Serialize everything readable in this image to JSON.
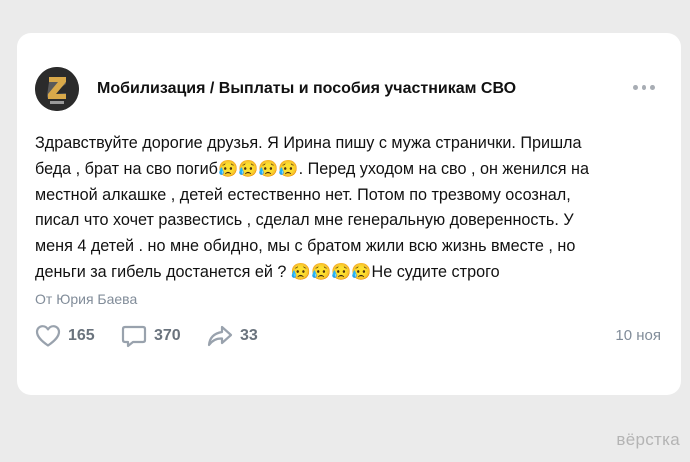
{
  "post": {
    "group_name": "Мобилизация / Выплаты и пособия участникам СВО",
    "text": "Здравствуйте дорогие друзья. Я Ирина пишу с мужа странички. Пришла\nбеда , брат на сво погиб😥😥😥😥. Перед уходом на сво , он женился на\nместной алкашке , детей естественно нет. Потом по трезвому осознал,\nписал что хочет развестись , сделал мне генеральную доверенность. У\nменя 4 детей . но мне обидно, мы с братом жили всю жизнь вместе , но\nденьги за гибель достанется ей ? 😥😥😥😥Не судите строго",
    "author": "От Юрия Баева",
    "likes": "165",
    "comments": "370",
    "shares": "33",
    "date": "10 ноя",
    "icons": {
      "more": "more-dots-icon",
      "like": "heart-icon",
      "comment": "comment-icon",
      "share": "share-arrow-icon"
    }
  },
  "watermark": "вёрстка",
  "colors": {
    "background": "#ebebeb",
    "card": "#ffffff",
    "meta_text": "#818c99",
    "counter_text": "#6a737d",
    "icon": "#99a2ad"
  }
}
